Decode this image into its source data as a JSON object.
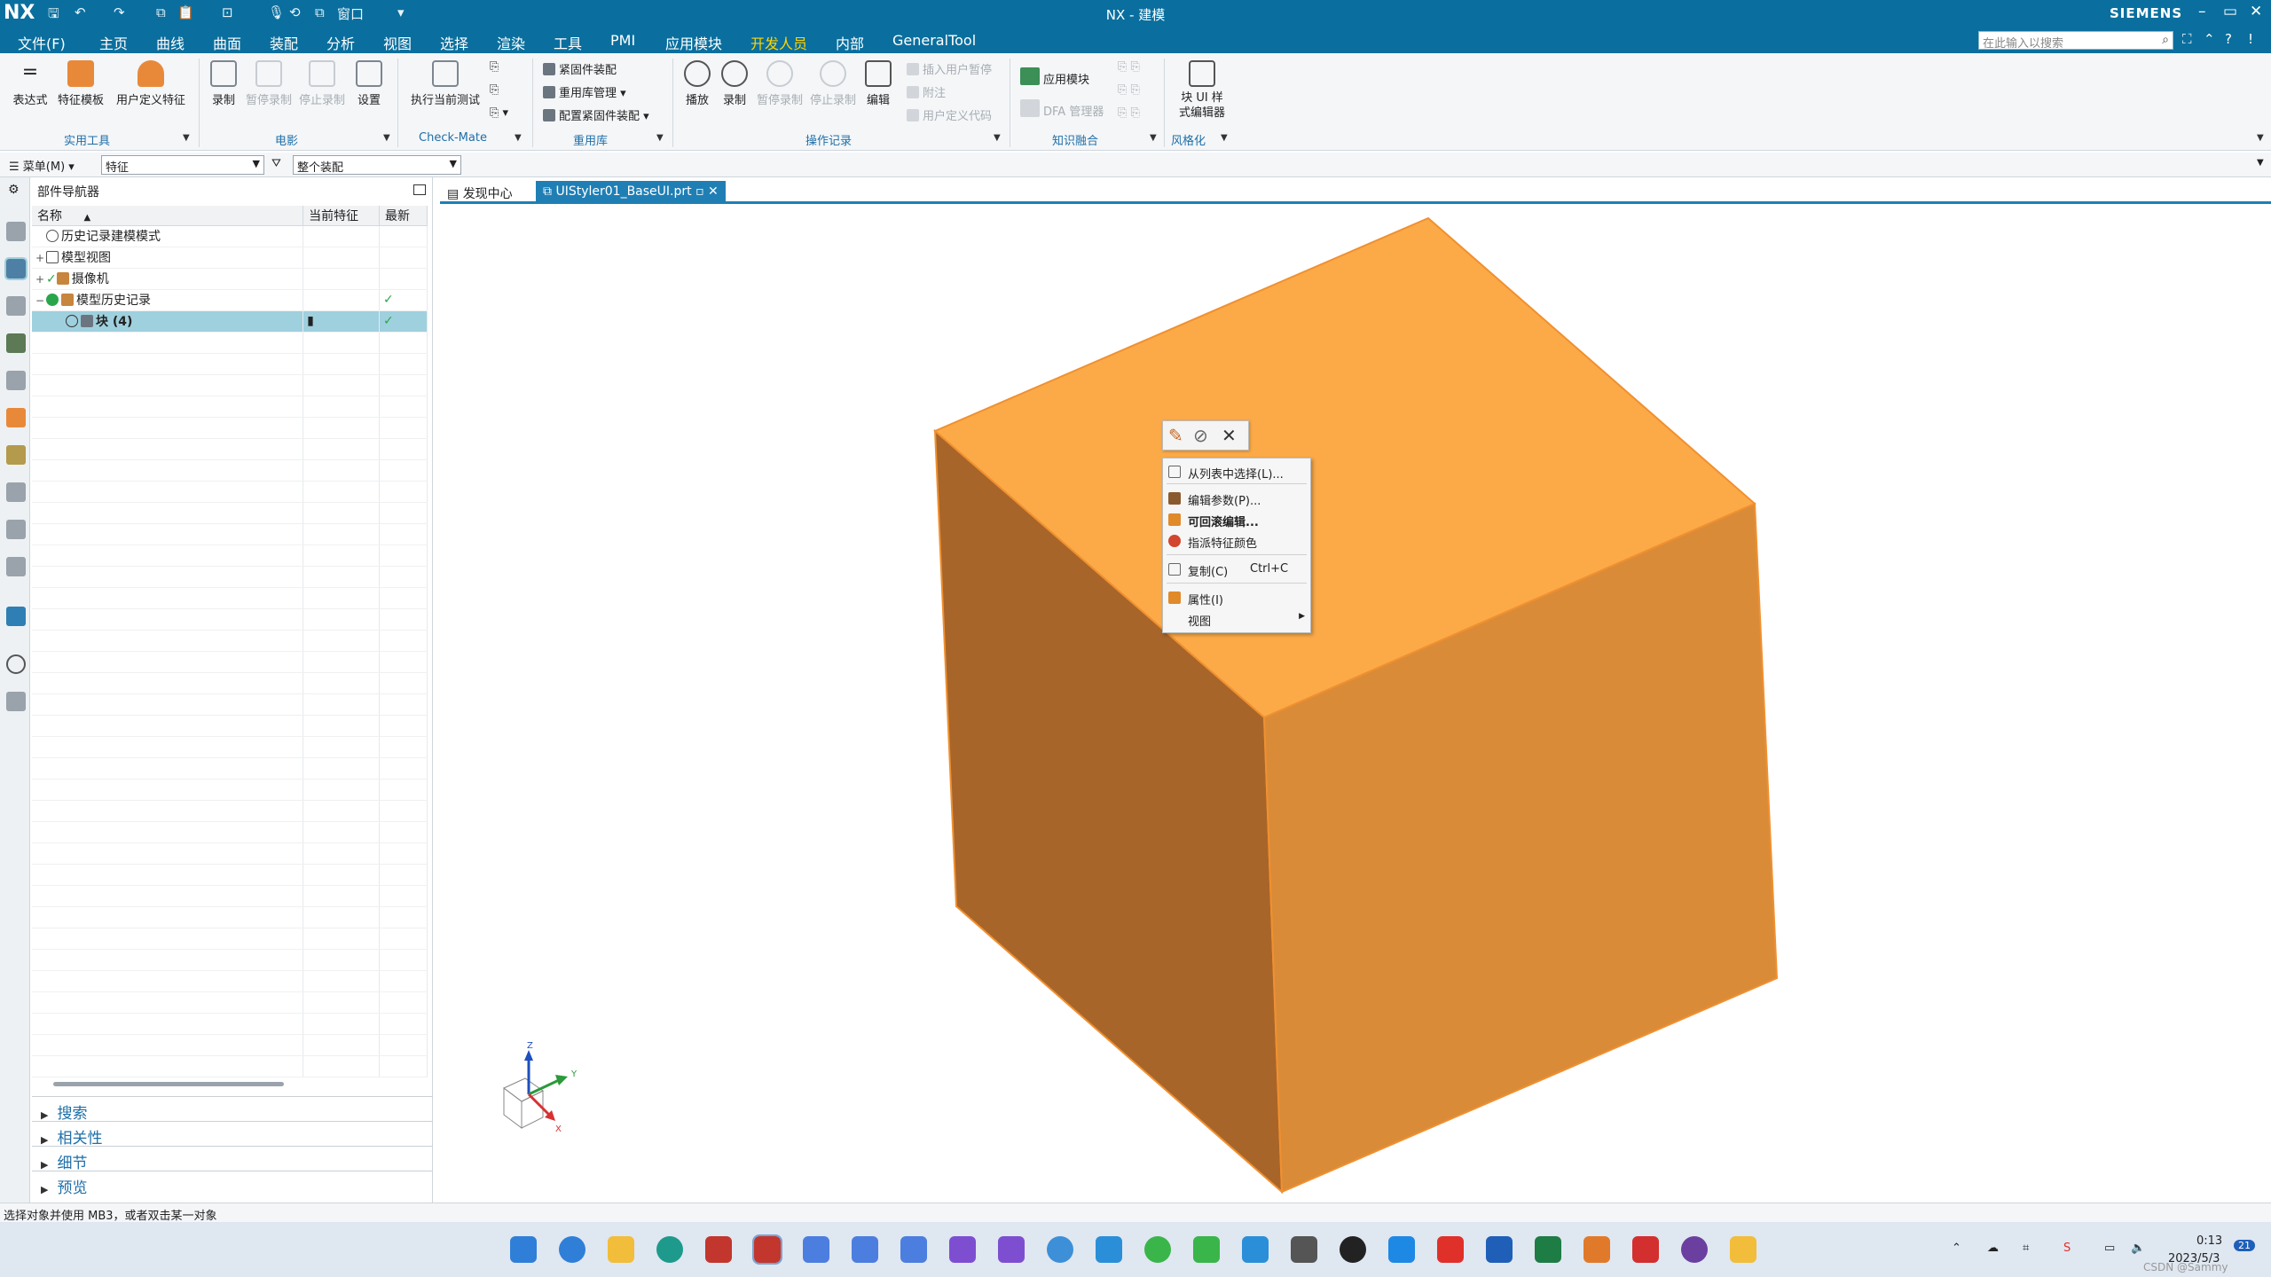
{
  "titlebar": {
    "logo": "NX",
    "title": "NX - 建模",
    "brand": "SIEMENS",
    "window_label": "窗口",
    "minimize": "–",
    "restore": "▭",
    "close": "✕"
  },
  "menubar": {
    "items": [
      "文件(F)",
      "主页",
      "曲线",
      "曲面",
      "装配",
      "分析",
      "视图",
      "选择",
      "渲染",
      "工具",
      "PMI",
      "应用模块",
      "开发人员",
      "内部",
      "GeneralTool"
    ],
    "active": "开发人员",
    "search_placeholder": "在此输入以搜索"
  },
  "ribbon": {
    "groups": {
      "utility": "实用工具",
      "movie": "电影",
      "checkmate": "Check-Mate",
      "reuse": "重用库",
      "journal": "操作记录",
      "kf": "知识融合",
      "style": "风格化"
    },
    "buttons": {
      "expression": "表达式",
      "feature_template": "特征模板",
      "udf": "用户定义特征",
      "record_movie": "录制",
      "pause_movie": "暂停录制",
      "stop_movie": "停止录制",
      "settings": "设置",
      "run_test": "执行当前测试",
      "fastener": "紧固件装配",
      "reuse_mgmt": "重用库管理",
      "config_fastener": "配置紧固件装配",
      "play": "播放",
      "record_journal": "录制",
      "pause_journal": "暂停录制",
      "stop_journal": "停止录制",
      "edit_journal": "编辑",
      "insert_pause": "插入用户暂停",
      "comment": "附注",
      "user_code": "用户定义代码",
      "app_module": "应用模块",
      "dfa_manager": "DFA 管理器",
      "block_styler": "块 UI 样式编辑器"
    }
  },
  "selbar": {
    "menu": "菜单(M)",
    "filter": "特征",
    "scope": "整个装配"
  },
  "navigator": {
    "title": "部件导航器",
    "columns": [
      "名称",
      "当前特征",
      "最新"
    ],
    "rows": [
      {
        "toggle": "",
        "label": "历史记录建模模式",
        "current": "",
        "latest": "",
        "selected": false
      },
      {
        "toggle": "+",
        "label": "模型视图",
        "current": "",
        "latest": "",
        "selected": false
      },
      {
        "toggle": "+",
        "label": "摄像机",
        "current": "",
        "latest": "",
        "selected": false
      },
      {
        "toggle": "−",
        "label": "模型历史记录",
        "current": "",
        "latest": "✓",
        "selected": false
      },
      {
        "toggle": "",
        "label": "块 (4)",
        "current": "▮",
        "latest": "✓",
        "selected": true
      }
    ],
    "panels": [
      "搜索",
      "相关性",
      "细节",
      "预览"
    ]
  },
  "tabs": [
    {
      "label": "发现中心",
      "active": false
    },
    {
      "label": "UIStyler01_BaseUI.prt",
      "active": true
    }
  ],
  "context_menu": {
    "items": [
      {
        "label": "从列表中选择(L)...",
        "shortcut": "",
        "bold": false
      },
      {
        "label": "编辑参数(P)...",
        "shortcut": "",
        "bold": false
      },
      {
        "label": "可回滚编辑...",
        "shortcut": "",
        "bold": true
      },
      {
        "label": "指派特征颜色",
        "shortcut": "",
        "bold": false
      },
      {
        "label": "复制(C)",
        "shortcut": "Ctrl+C",
        "bold": false
      },
      {
        "label": "属性(I)",
        "shortcut": "",
        "bold": false
      },
      {
        "label": "视图",
        "shortcut": "",
        "bold": false
      }
    ]
  },
  "triad": {
    "x": "X",
    "y": "Y",
    "z": "Z"
  },
  "status": "选择对象并使用 MB3，或者双击某一对象",
  "taskbar": {
    "time": "0:13",
    "date": "2023/5/3",
    "notification_count": "21",
    "watermark": "CSDN @Sammy"
  },
  "colors": {
    "brand": "#0a6f9e",
    "active_menu": "#ffd400",
    "cube_top": "#fcaa48",
    "cube_left": "#a8652a",
    "cube_right": "#da8b38",
    "selection": "#9fd0de"
  }
}
